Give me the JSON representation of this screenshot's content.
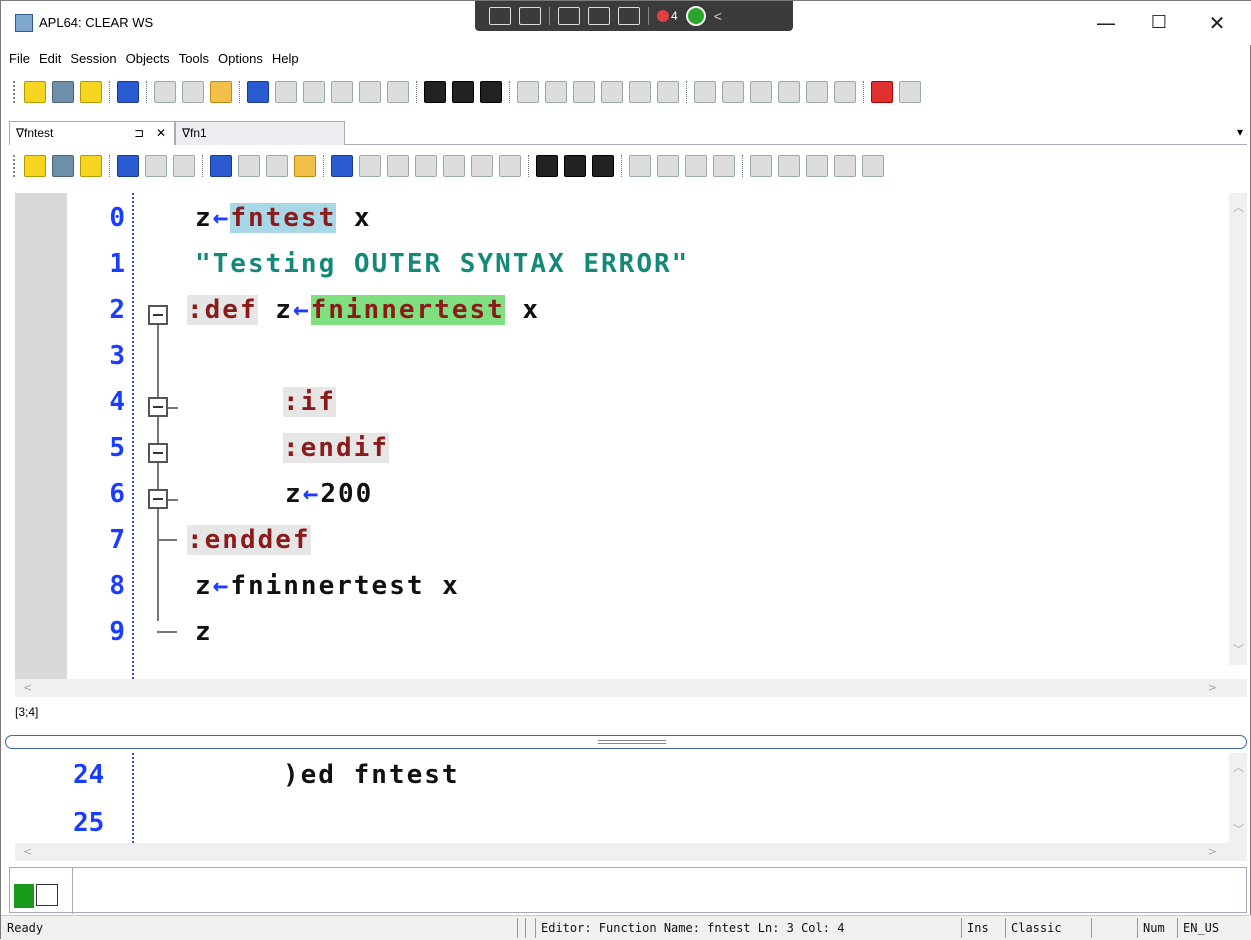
{
  "window": {
    "title": "APL64: CLEAR WS"
  },
  "capture_bar": {
    "rec_count": "4"
  },
  "menu": [
    "File",
    "Edit",
    "Session",
    "Objects",
    "Tools",
    "Options",
    "Help"
  ],
  "tabs": [
    {
      "label": "∇fntest",
      "active": true,
      "pin": "⊐",
      "close": "✕"
    },
    {
      "label": "∇fn1",
      "active": false
    }
  ],
  "editor": {
    "lines": [
      {
        "n": "0"
      },
      {
        "n": "1"
      },
      {
        "n": "2"
      },
      {
        "n": "3"
      },
      {
        "n": "4"
      },
      {
        "n": "5"
      },
      {
        "n": "6"
      },
      {
        "n": "7"
      },
      {
        "n": "8"
      },
      {
        "n": "9"
      }
    ],
    "code": {
      "l0a": "z",
      "l0arrow": "←",
      "l0fn": "fntest",
      "l0b": " x",
      "l1": "\"Testing OUTER SYNTAX ERROR\"",
      "l2kw": ":def",
      "l2a": " z",
      "l2arrow": "←",
      "l2fn": "fninnertest",
      "l2b": " x",
      "l4": ":if",
      "l5": ":endif",
      "l6a": "z",
      "l6arrow": "←",
      "l6b": "200",
      "l7": ":enddef",
      "l8a": "z",
      "l8arrow": "←",
      "l8b": "fninnertest x",
      "l9": "z"
    },
    "cursor_pos": "[3;4]"
  },
  "session": {
    "lines": [
      {
        "n": "24",
        "code": ")ed fntest"
      },
      {
        "n": "25",
        "code": ""
      }
    ]
  },
  "status": {
    "ready": "Ready",
    "editor_info": "Editor: Function Name: fntest Ln: 3 Col: 4",
    "mode": "Ins",
    "keyboard": "Classic",
    "num": "Num",
    "locale": "EN_US"
  },
  "icons": {
    "minimize": "—",
    "maximize": "☐",
    "close": "✕"
  }
}
